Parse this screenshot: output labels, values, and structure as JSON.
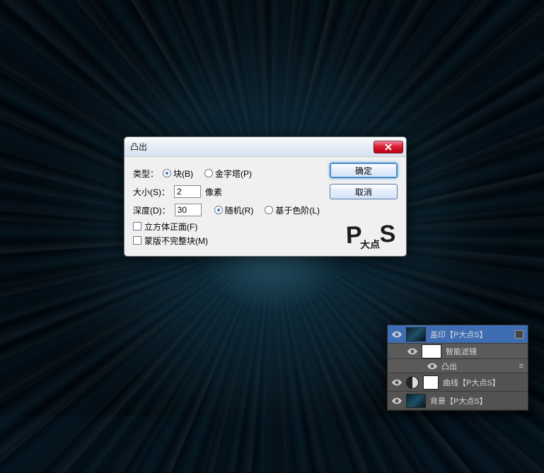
{
  "dialog": {
    "title": "凸出",
    "type_label": "类型：",
    "type_opts": {
      "blocks": "块(B)",
      "pyramids": "金字塔(P)"
    },
    "type_selected": "blocks",
    "size_label": "大小(S)：",
    "size_value": "2",
    "size_unit": "像素",
    "depth_label": "深度(D)：",
    "depth_value": "30",
    "depth_opts": {
      "random": "随机(R)",
      "level": "基于色阶(L)"
    },
    "depth_selected": "random",
    "chk_solid": "立方体正面(F)",
    "chk_mask": "蒙版不完整块(M)",
    "ok": "确定",
    "cancel": "取消",
    "logo": "P",
    "logo_small": "大点",
    "logo_s": "S"
  },
  "layers": {
    "items": [
      {
        "vis": true,
        "name": "盖印【P大点S】",
        "thumb": "img",
        "smart": true,
        "selected": true,
        "indent": 0
      },
      {
        "vis": true,
        "name": "智能滤镜",
        "thumb": "white",
        "smart": false,
        "selected": false,
        "indent": 1
      },
      {
        "vis": true,
        "name": "凸出",
        "thumb": "none",
        "smart": false,
        "selected": false,
        "indent": 2,
        "fx": true
      },
      {
        "vis": true,
        "name": "曲线【P大点S】",
        "thumb": "adj",
        "smart": false,
        "selected": false,
        "indent": 0,
        "mask": true
      },
      {
        "vis": true,
        "name": "背景【P大点S】",
        "thumb": "img",
        "smart": false,
        "selected": false,
        "indent": 0
      }
    ]
  }
}
